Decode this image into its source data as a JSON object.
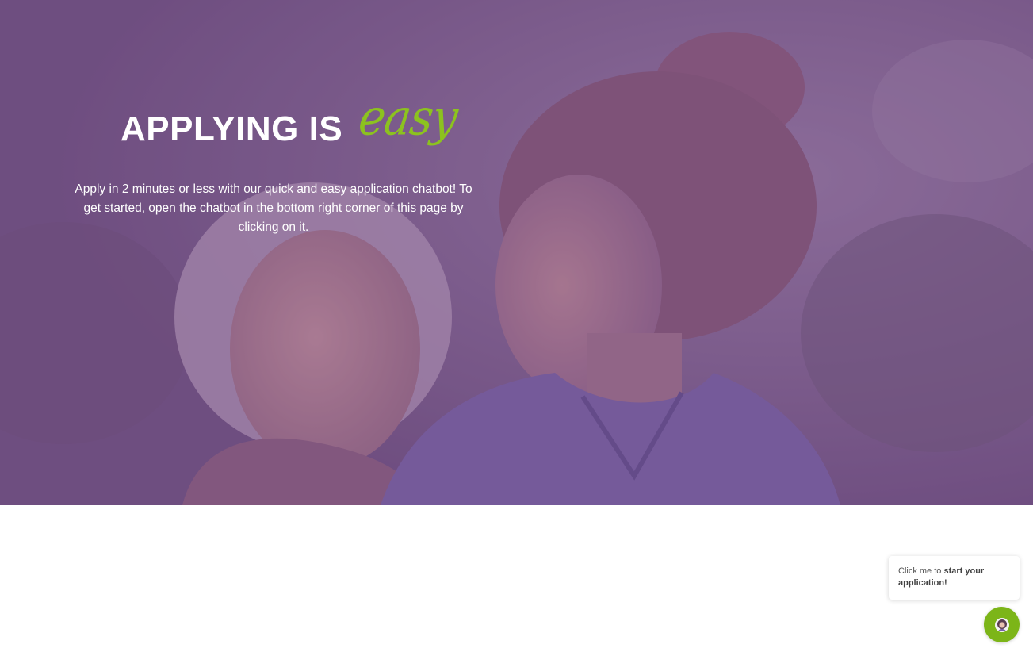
{
  "hero": {
    "heading_bold": "APPLYING IS",
    "heading_script": "easy",
    "description": "Apply in 2 minutes or less with our quick and easy application chatbot! To get started, open the chatbot in the bottom right corner of this page by clicking on it.",
    "image_subject": "elderly woman and young caregiver in scrubs smiling"
  },
  "chat_widget": {
    "tooltip_prefix": "Click me to ",
    "tooltip_bold": "start your application!",
    "button_icon": "chatbot-avatar-icon"
  },
  "colors": {
    "overlay": "#7f5d8c",
    "accent_green": "#8cc21f",
    "chat_button": "#7cb518",
    "text_light": "#ffffff"
  }
}
